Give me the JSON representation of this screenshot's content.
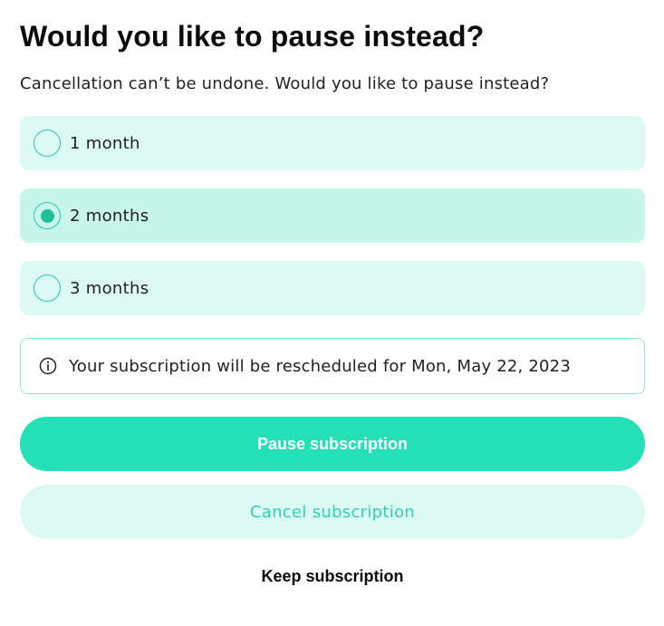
{
  "dialog": {
    "title": "Would you like to pause instead?",
    "subtitle": "Cancellation can’t be undone. Would you like to pause instead?"
  },
  "options": [
    {
      "label": "1 month",
      "selected": false
    },
    {
      "label": "2 months",
      "selected": true
    },
    {
      "label": "3 months",
      "selected": false
    }
  ],
  "info": {
    "icon": "info-icon",
    "text": "Your subscription will be rescheduled for Mon, May 22, 2023"
  },
  "actions": {
    "pause_label": "Pause subscription",
    "cancel_label": "Cancel subscription",
    "keep_label": "Keep subscription"
  },
  "colors": {
    "accent": "#25e0b7",
    "option_bg": "#ddf9f3",
    "option_selected_bg": "#c8f6ea",
    "radio": "#1fbf99"
  }
}
